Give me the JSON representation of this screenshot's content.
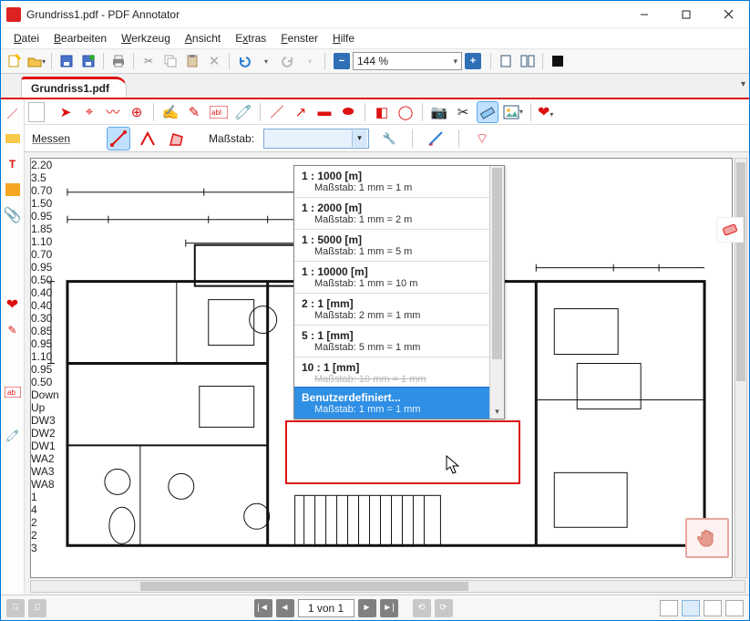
{
  "title": "Grundriss1.pdf - PDF Annotator",
  "menu": {
    "file": "Datei",
    "edit": "Bearbeiten",
    "tool": "Werkzeug",
    "view": "Ansicht",
    "extras": "Extras",
    "window": "Fenster",
    "help": "Hilfe"
  },
  "zoom": {
    "value": "144 %"
  },
  "tab": {
    "name": "Grundriss1.pdf"
  },
  "row2": {
    "measure": "Messen",
    "scale": "Maßstab:"
  },
  "dropdown": {
    "items": [
      {
        "t1": "1 : 1000 [m]",
        "t2": "Maßstab: 1 mm = 1 m"
      },
      {
        "t1": "1 : 2000 [m]",
        "t2": "Maßstab: 1 mm = 2 m"
      },
      {
        "t1": "1 : 5000 [m]",
        "t2": "Maßstab: 1 mm = 5 m"
      },
      {
        "t1": "1 : 10000 [m]",
        "t2": "Maßstab: 1 mm = 10 m"
      },
      {
        "t1": "2 : 1 [mm]",
        "t2": "Maßstab: 2 mm = 1 mm"
      },
      {
        "t1": "5 : 1 [mm]",
        "t2": "Maßstab: 5 mm = 1 mm"
      },
      {
        "t1": "10 : 1 [mm]",
        "t2": "Maßstab: 10 mm = 1 mm"
      }
    ],
    "custom": {
      "t1": "Benutzerdefiniert...",
      "t2": "Maßstab: 1 mm = 1 mm"
    }
  },
  "pager": {
    "text": "1 von 1"
  },
  "floorplan": {
    "dims": {
      "a": "2.20",
      "b": "3.5",
      "c": "0.70",
      "d": "1.50",
      "e": "0.95",
      "f": "1.85",
      "g": "1.10",
      "h": "0.70",
      "i": "0.95",
      "j": "0.50",
      "k": "0.40",
      "l": "0.40",
      "m": "0.30",
      "n": "0.85",
      "o": "0.95",
      "p": "1.10",
      "q": "0.95",
      "r": "0.50",
      "down": "Down",
      "up": "Up",
      "dw1": "DW1",
      "dw2": "DW2",
      "dw3": "DW3",
      "wa2": "WA2",
      "wa3": "WA3",
      "wa8": "WA8",
      "n1": "1",
      "n2": "2",
      "n3": "3",
      "n4": "4"
    }
  }
}
